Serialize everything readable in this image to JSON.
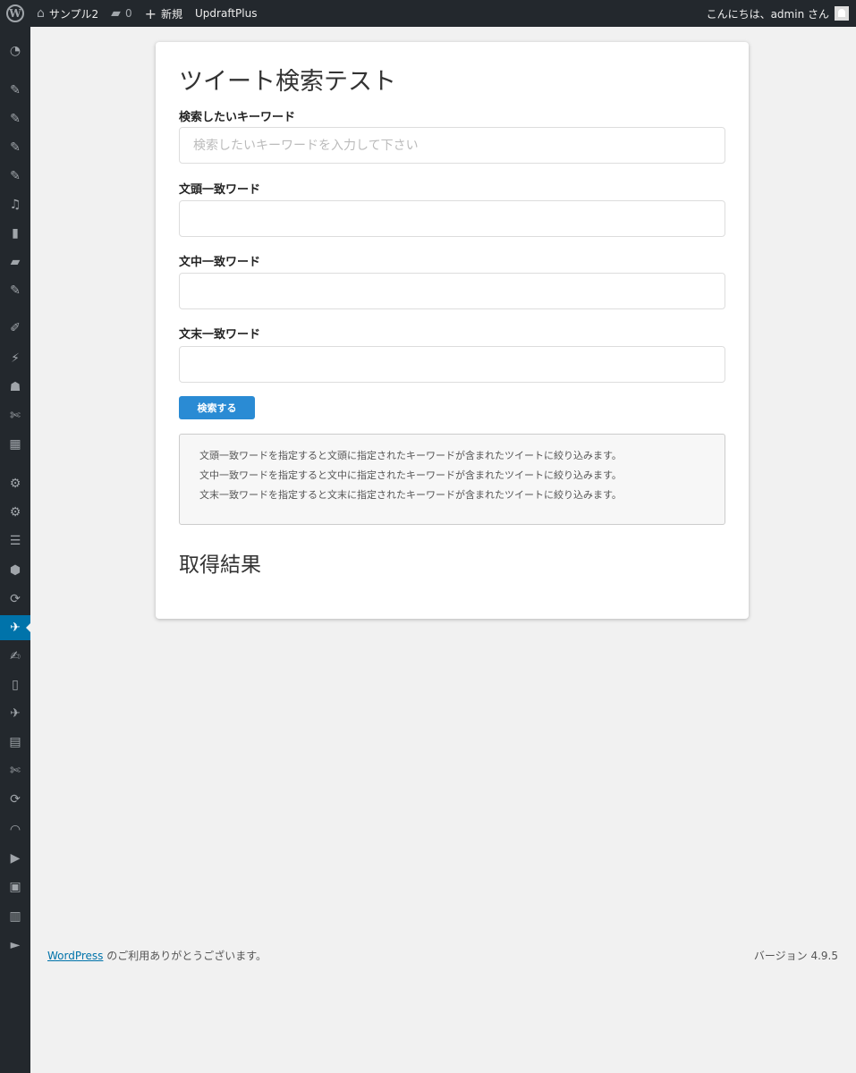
{
  "adminbar": {
    "site_name": "サンプル2",
    "comments_count": "0",
    "new_label": "新規",
    "plugin_label": "UpdraftPlus",
    "greeting": "こんにちは、admin さん"
  },
  "sidebar": {
    "items": [
      {
        "icon": "dashboard-icon",
        "glyph": "◔"
      },
      {
        "icon": "pin-icon",
        "glyph": "✎"
      },
      {
        "icon": "pin-icon",
        "glyph": "✎"
      },
      {
        "icon": "pin-icon",
        "glyph": "✎"
      },
      {
        "icon": "pin-icon",
        "glyph": "✎"
      },
      {
        "icon": "media-icon",
        "glyph": "♫"
      },
      {
        "icon": "pages-icon",
        "glyph": "▮"
      },
      {
        "icon": "comments-icon",
        "glyph": "▰"
      },
      {
        "icon": "pin-icon",
        "glyph": "✎"
      },
      {
        "icon": "appearance-icon",
        "glyph": "✐"
      },
      {
        "icon": "plugins-icon",
        "glyph": "⚡"
      },
      {
        "icon": "users-icon",
        "glyph": "☗"
      },
      {
        "icon": "tools-icon",
        "glyph": "✄"
      },
      {
        "icon": "widget-icon",
        "glyph": "▦"
      },
      {
        "icon": "gear-icon",
        "glyph": "⚙"
      },
      {
        "icon": "gear-icon",
        "glyph": "⚙"
      },
      {
        "icon": "elementor-icon",
        "glyph": "☰"
      },
      {
        "icon": "plugin-logo-icon",
        "glyph": "⬢"
      },
      {
        "icon": "sync-icon",
        "glyph": "⟳"
      },
      {
        "icon": "twitter-icon",
        "glyph": "✈",
        "current": true
      },
      {
        "icon": "edit-icon",
        "glyph": "✍"
      },
      {
        "icon": "mobile-icon",
        "glyph": "▯"
      },
      {
        "icon": "twitter-icon",
        "glyph": "✈"
      },
      {
        "icon": "layout-icon",
        "glyph": "▤"
      },
      {
        "icon": "tools-icon",
        "glyph": "✄"
      },
      {
        "icon": "sync-icon",
        "glyph": "⟳"
      },
      {
        "icon": "rss-icon",
        "glyph": "◠"
      },
      {
        "icon": "video-icon",
        "glyph": "▶"
      },
      {
        "icon": "calendar-icon",
        "glyph": "▣"
      },
      {
        "icon": "book-icon",
        "glyph": "▥"
      },
      {
        "icon": "play-circle-icon",
        "glyph": "►"
      }
    ]
  },
  "main": {
    "title": "ツイート検索テスト",
    "keyword_label": "検索したいキーワード",
    "keyword_placeholder": "検索したいキーワードを入力して下さい",
    "prefix_label": "文頭一致ワード",
    "middle_label": "文中一致ワード",
    "suffix_label": "文末一致ワード",
    "search_button": "検索する",
    "help_lines": [
      "文頭一致ワードを指定すると文頭に指定されたキーワードが含まれたツイートに絞り込みます。",
      "文中一致ワードを指定すると文中に指定されたキーワードが含まれたツイートに絞り込みます。",
      "文末一致ワードを指定すると文末に指定されたキーワードが含まれたツイートに絞り込みます。"
    ],
    "results_title": "取得結果"
  },
  "footer": {
    "wp_link": "WordPress",
    "thanks": " のご利用ありがとうございます。",
    "version": "バージョン 4.9.5"
  },
  "colors": {
    "adminbar_bg": "#23282d",
    "accent": "#0073aa",
    "button": "#2a8bd4"
  }
}
